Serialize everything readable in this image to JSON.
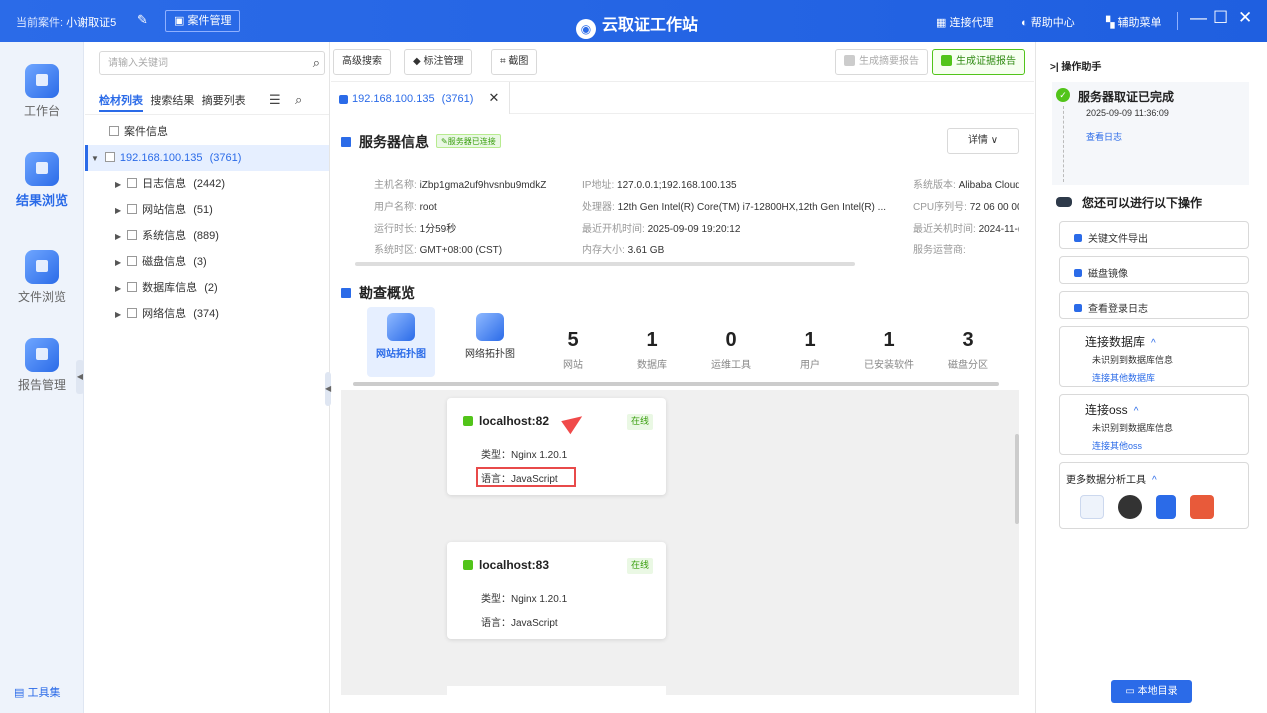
{
  "topbar": {
    "case_label": "当前案件:",
    "case_name": "小谢取证5",
    "case_mgmt": "案件管理",
    "title": "云取证工作站",
    "connect_proxy": "连接代理",
    "help_center": "帮助中心",
    "aux_menu": "辅助菜单"
  },
  "nav": {
    "items": [
      {
        "label": "工作台"
      },
      {
        "label": "结果浏览"
      },
      {
        "label": "文件浏览"
      },
      {
        "label": "报告管理"
      }
    ],
    "tools": "工具集"
  },
  "tree": {
    "search_placeholder": "请输入关键词",
    "tabs": [
      "检材列表",
      "搜索结果",
      "摘要列表"
    ],
    "case_info": "案件信息",
    "host": "192.168.100.135",
    "host_count": "(3761)",
    "children": [
      {
        "label": "日志信息",
        "count": "(2442)"
      },
      {
        "label": "网站信息",
        "count": "(51)"
      },
      {
        "label": "系统信息",
        "count": "(889)"
      },
      {
        "label": "磁盘信息",
        "count": "(3)"
      },
      {
        "label": "数据库信息",
        "count": "(2)"
      },
      {
        "label": "网络信息",
        "count": "(374)"
      }
    ]
  },
  "toolbar": {
    "advanced_search": "高级搜索",
    "tag_mgmt": "标注管理",
    "screenshot": "截图",
    "gen_summary": "生成摘要报告",
    "gen_evidence": "生成证据报告"
  },
  "doc_tab": {
    "label": "192.168.100.135",
    "count": "(3761)"
  },
  "server": {
    "title": "服务器信息",
    "badge": "服务器已连接",
    "detail": "详情",
    "fields": [
      {
        "k": "主机名称:",
        "v": "iZbp1gma2uf9hvsnbu9mdkZ"
      },
      {
        "k": "IP地址:",
        "v": "127.0.0.1;192.168.100.135"
      },
      {
        "k": "系统版本:",
        "v": "Alibaba Cloud"
      },
      {
        "k": "用户名称:",
        "v": "root"
      },
      {
        "k": "处理器:",
        "v": "12th Gen Intel(R) Core(TM) i7-12800HX,12th Gen Intel(R) ..."
      },
      {
        "k": "CPU序列号:",
        "v": "72 06 00 00"
      },
      {
        "k": "运行时长:",
        "v": "1分59秒"
      },
      {
        "k": "最近开机时间:",
        "v": "2025-09-09 19:20:12"
      },
      {
        "k": "最近关机时间:",
        "v": "2024-11-("
      },
      {
        "k": "系统时区:",
        "v": "GMT+08:00 (CST)"
      },
      {
        "k": "内存大小:",
        "v": "3.61 GB"
      },
      {
        "k": "服务运营商:",
        "v": ""
      }
    ]
  },
  "overview": {
    "title": "勘查概览",
    "tiles": [
      {
        "label": "网站拓扑图"
      },
      {
        "label": "网络拓扑图"
      }
    ],
    "stats": [
      {
        "n": "5",
        "l": "网站"
      },
      {
        "n": "1",
        "l": "数据库"
      },
      {
        "n": "0",
        "l": "运维工具"
      },
      {
        "n": "1",
        "l": "用户"
      },
      {
        "n": "1",
        "l": "已安装软件"
      },
      {
        "n": "3",
        "l": "磁盘分区"
      }
    ]
  },
  "cards": [
    {
      "host": "localhost:82",
      "status": "在线",
      "type": "类型：Nginx 1.20.1",
      "lang": "语言：JavaScript"
    },
    {
      "host": "localhost:83",
      "status": "在线",
      "type": "类型：Nginx 1.20.1",
      "lang": "语言：JavaScript"
    }
  ],
  "right": {
    "head": "操作助手",
    "done_title": "服务器取证已完成",
    "done_time": "2025-09-09 11:36:09",
    "view_log": "查看日志",
    "more_ops": "您还可以进行以下操作",
    "btn_export": "关键文件导出",
    "btn_mirror": "磁盘镜像",
    "btn_login_log": "查看登录日志",
    "db_title": "连接数据库",
    "db_s1": "未识别到数据库信息",
    "db_s2": "连接其他数据库",
    "oss_title": "连接oss",
    "oss_s1": "未识别到数据库信息",
    "oss_s2": "连接其他oss",
    "tools_title": "更多数据分析工具",
    "local_dir": "本地目录"
  },
  "colors": {
    "accent": "#2b6be8",
    "success": "#52c41a",
    "alert": "#e84a4a"
  }
}
